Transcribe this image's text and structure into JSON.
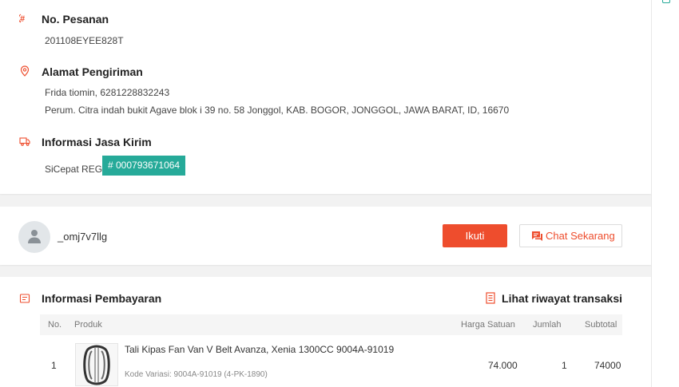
{
  "order": {
    "number_title": "No. Pesanan",
    "number_value": "201108EYEE828T",
    "address_title": "Alamat Pengiriman",
    "recipient": "Frida tiomin, 6281228832243",
    "address": "Perum. Citra indah bukit Agave blok i 39 no. 58 Jonggol, KAB. BOGOR, JONGGOL, JAWA BARAT, ID, 16670",
    "shipping_title": "Informasi Jasa Kirim",
    "courier": "SiCepat REG",
    "tracking": "# 000793671064"
  },
  "shop": {
    "name": "_omj7v7llg",
    "follow_label": "Ikuti",
    "chat_label": "Chat Sekarang"
  },
  "payment": {
    "title": "Informasi Pembayaran",
    "history_label": "Lihat riwayat transaksi",
    "columns": {
      "no": "No.",
      "product": "Produk",
      "unit_price": "Harga Satuan",
      "qty": "Jumlah",
      "subtotal": "Subtotal"
    },
    "rows": [
      {
        "no": "1",
        "name": "Tali Kipas Fan Van V Belt Avanza, Xenia 1300CC 9004A-91019",
        "variant": "Kode Variasi: 9004A-91019 (4-PK-1890)",
        "unit_price": "74.000",
        "qty": "1",
        "subtotal": "74000"
      }
    ]
  },
  "colors": {
    "accent": "#ee4d2d",
    "teal": "#26aa99"
  },
  "icons": [
    "hash-icon",
    "location-pin-icon",
    "truck-icon",
    "user-icon",
    "chat-icon",
    "receipt-icon",
    "document-icon"
  ]
}
